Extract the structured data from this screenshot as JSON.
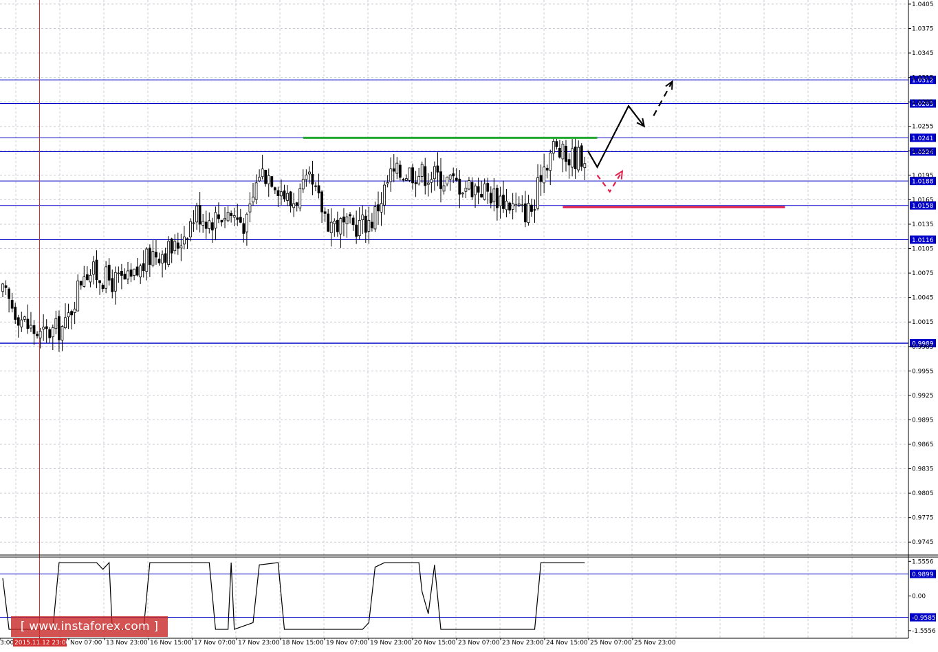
{
  "chart_data": {
    "type": "candlestick",
    "price_axis": {
      "range": [
        0.973,
        1.041
      ],
      "ticks": [
        "1.0405",
        "1.0375",
        "1.0345",
        "1.0315",
        "1.0285",
        "1.0255",
        "1.0225",
        "1.0195",
        "1.0165",
        "1.0135",
        "1.0105",
        "1.0075",
        "1.0045",
        "1.0015",
        "0.9985",
        "0.9955",
        "0.9925",
        "0.9895",
        "0.9865",
        "0.9835",
        "0.9805",
        "0.9775",
        "0.9745"
      ]
    },
    "time_axis": {
      "labels": [
        "3:00",
        "2015.11.12 23:00",
        "Nov 07:00",
        "13 Nov 23:00",
        "16 Nov 15:00",
        "17 Nov 07:00",
        "17 Nov 23:00",
        "18 Nov 15:00",
        "19 Nov 07:00",
        "19 Nov 23:00",
        "20 Nov 15:00",
        "23 Nov 07:00",
        "23 Nov 23:00",
        "24 Nov 15:00",
        "25 Nov 07:00",
        "25 Nov 23:00"
      ],
      "highlighted": "2015.11.12 23:00"
    },
    "horizontal_levels": [
      {
        "label": "1.0312",
        "value": 1.0312
      },
      {
        "label": "1.0283",
        "value": 1.0283
      },
      {
        "label": "1.0241",
        "value": 1.0241
      },
      {
        "label": "1.0224",
        "value": 1.0224
      },
      {
        "label": "1.0188",
        "value": 1.0188
      },
      {
        "label": "1.0158",
        "value": 1.0158
      },
      {
        "label": "1.0116",
        "value": 1.0116
      },
      {
        "label": "0.9989",
        "value": 0.9989
      }
    ],
    "vertical_marker_bar": 10,
    "green_line": {
      "value": 1.0241,
      "bar_from": 96,
      "bar_to": 190
    },
    "red_line": {
      "value": 1.0156,
      "bar_from": 179,
      "bar_to": 250
    },
    "close_path": [
      {
        "bar": 0,
        "price": 1.005
      },
      {
        "bar": 8,
        "price": 1.001
      },
      {
        "bar": 12,
        "price": 0.9998
      },
      {
        "bar": 20,
        "price": 1.001
      },
      {
        "bar": 26,
        "price": 1.008
      },
      {
        "bar": 35,
        "price": 1.0065
      },
      {
        "bar": 41,
        "price": 1.0065
      },
      {
        "bar": 48,
        "price": 1.01
      },
      {
        "bar": 55,
        "price": 1.0105
      },
      {
        "bar": 62,
        "price": 1.015
      },
      {
        "bar": 66,
        "price": 1.014
      },
      {
        "bar": 72,
        "price": 1.015
      },
      {
        "bar": 78,
        "price": 1.0135
      },
      {
        "bar": 82,
        "price": 1.02
      },
      {
        "bar": 86,
        "price": 1.0195
      },
      {
        "bar": 92,
        "price": 1.016
      },
      {
        "bar": 98,
        "price": 1.0185
      },
      {
        "bar": 104,
        "price": 1.014
      },
      {
        "bar": 110,
        "price": 1.013
      },
      {
        "bar": 118,
        "price": 1.014
      },
      {
        "bar": 124,
        "price": 1.0195
      },
      {
        "bar": 130,
        "price": 1.02
      },
      {
        "bar": 138,
        "price": 1.0195
      },
      {
        "bar": 145,
        "price": 1.0185
      },
      {
        "bar": 152,
        "price": 1.018
      },
      {
        "bar": 160,
        "price": 1.0165
      },
      {
        "bar": 166,
        "price": 1.015
      },
      {
        "bar": 170,
        "price": 1.0155
      },
      {
        "bar": 172,
        "price": 1.02
      },
      {
        "bar": 176,
        "price": 1.023
      },
      {
        "bar": 180,
        "price": 1.0215
      },
      {
        "bar": 186,
        "price": 1.022
      }
    ],
    "forecast": {
      "solid": [
        {
          "bar": 187,
          "price": 1.0225
        },
        {
          "bar": 190,
          "price": 1.0205
        },
        {
          "bar": 200,
          "price": 1.028
        },
        {
          "bar": 205,
          "price": 1.0255
        }
      ],
      "dashed": [
        {
          "bar": 208,
          "price": 1.0268
        },
        {
          "bar": 214,
          "price": 1.031
        }
      ],
      "red_dashed": [
        {
          "bar": 190,
          "price": 1.0195
        },
        {
          "bar": 194,
          "price": 1.0175
        },
        {
          "bar": 198,
          "price": 1.02
        }
      ]
    },
    "indicator": {
      "range": [
        -1.9,
        1.75
      ],
      "ticks": [
        "1.5556",
        "0.00",
        "-1.5556"
      ],
      "levels": [
        {
          "label": "0.9899",
          "value": 0.9899
        },
        {
          "label": "-0.9585",
          "value": -0.9585
        }
      ],
      "path": [
        {
          "bar": 0,
          "value": 0.8
        },
        {
          "bar": 2,
          "value": -1.5
        },
        {
          "bar": 8,
          "value": -1.5
        },
        {
          "bar": 16,
          "value": -1.5
        },
        {
          "bar": 18,
          "value": 1.5
        },
        {
          "bar": 30,
          "value": 1.5
        },
        {
          "bar": 32,
          "value": 1.2
        },
        {
          "bar": 34,
          "value": 1.5
        },
        {
          "bar": 35,
          "value": -1.5
        },
        {
          "bar": 45,
          "value": -1.5
        },
        {
          "bar": 47,
          "value": 1.5
        },
        {
          "bar": 66,
          "value": 1.5
        },
        {
          "bar": 68,
          "value": -1.5
        },
        {
          "bar": 72,
          "value": -1.5
        },
        {
          "bar": 73,
          "value": 1.5
        },
        {
          "bar": 74,
          "value": -1.5
        },
        {
          "bar": 80,
          "value": -1.2
        },
        {
          "bar": 82,
          "value": 1.4
        },
        {
          "bar": 88,
          "value": 1.5
        },
        {
          "bar": 90,
          "value": -1.5
        },
        {
          "bar": 115,
          "value": -1.5
        },
        {
          "bar": 117,
          "value": -1.2
        },
        {
          "bar": 119,
          "value": 1.3
        },
        {
          "bar": 122,
          "value": 1.5
        },
        {
          "bar": 133,
          "value": 1.5
        },
        {
          "bar": 134,
          "value": 0.2
        },
        {
          "bar": 136,
          "value": -0.8
        },
        {
          "bar": 138,
          "value": 1.4
        },
        {
          "bar": 140,
          "value": -1.5
        },
        {
          "bar": 170,
          "value": -1.5
        },
        {
          "bar": 172,
          "value": 1.5
        },
        {
          "bar": 186,
          "value": 1.5
        }
      ]
    }
  },
  "watermark": "[ www.instaforex.com ]",
  "colors": {
    "level_line": "#0000c8",
    "green": "#22a832",
    "red": "#e0204a",
    "marker": "#d03030",
    "candle": "#000000"
  }
}
